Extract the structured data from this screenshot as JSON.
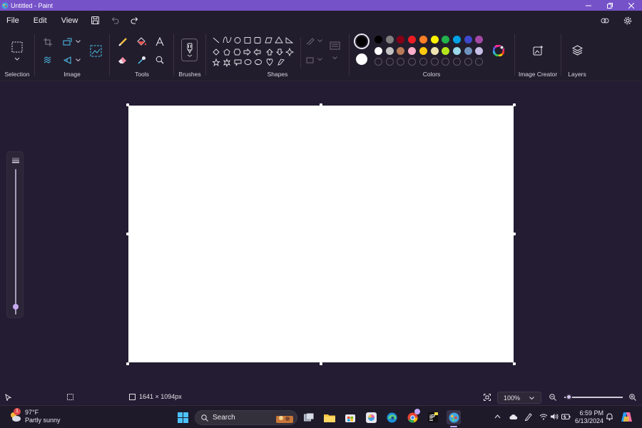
{
  "window": {
    "title": "Untitled - Paint"
  },
  "menu": {
    "file": "File",
    "edit": "Edit",
    "view": "View"
  },
  "ribbon": {
    "selection_label": "Selection",
    "image_label": "Image",
    "tools_label": "Tools",
    "brushes_label": "Brushes",
    "shapes_label": "Shapes",
    "colors_label": "Colors",
    "image_creator_label": "Image Creator",
    "layers_label": "Layers"
  },
  "colors": {
    "primary": "#000000",
    "secondary": "#ffffff",
    "row1": [
      "#000000",
      "#7f7f7f",
      "#880015",
      "#ed1c24",
      "#ff7f27",
      "#fff200",
      "#22b14c",
      "#00a2e8",
      "#3f48cc",
      "#a349a4"
    ],
    "row2": [
      "#ffffff",
      "#c3c3c3",
      "#b97a57",
      "#ffaec9",
      "#ffc90e",
      "#efe4b0",
      "#b5e61d",
      "#99d9ea",
      "#7092be",
      "#c8bfe7"
    ],
    "row3_empty_count": 10
  },
  "status": {
    "canvas_size": "1641 × 1094px",
    "zoom": "100%"
  },
  "taskbar": {
    "weather_temp": "97°F",
    "weather_desc": "Partly sunny",
    "weather_badge": "1",
    "search_label": "Search",
    "time": "6:59 PM",
    "date": "6/13/2024"
  }
}
